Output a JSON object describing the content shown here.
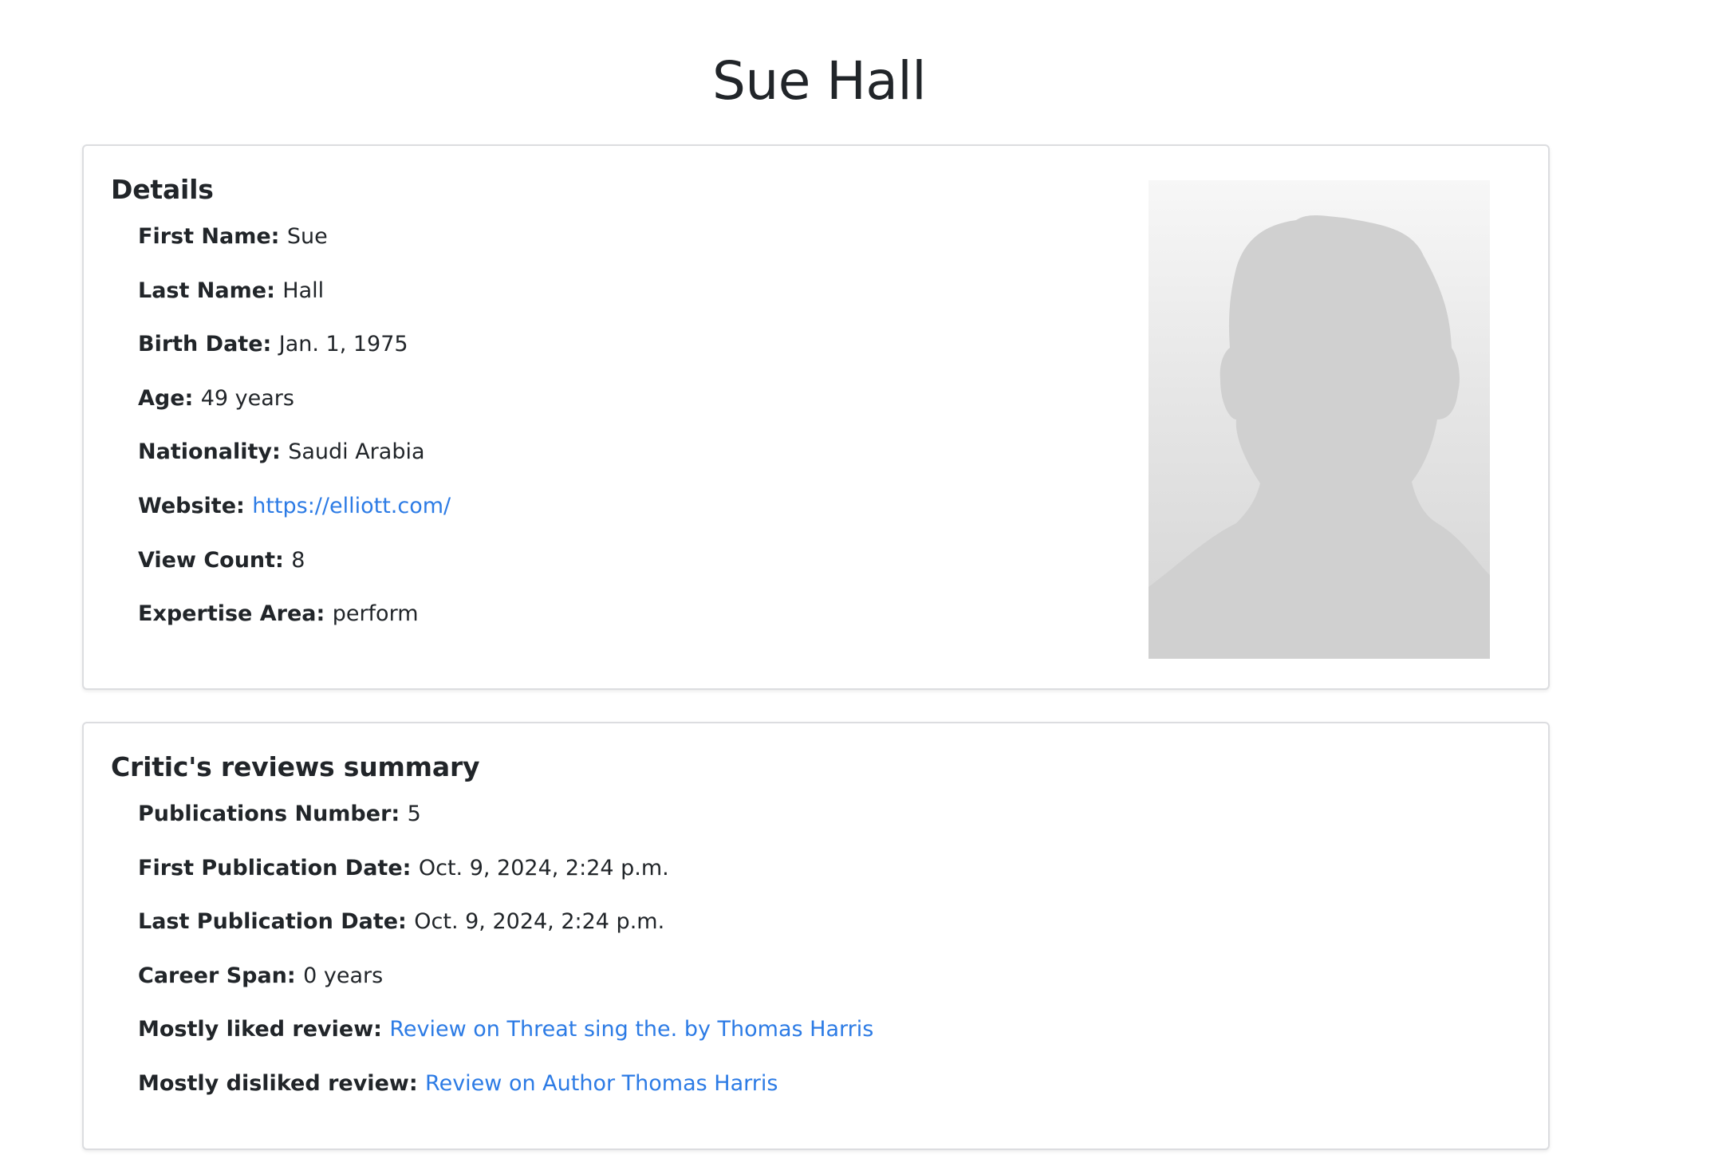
{
  "page": {
    "title": "Sue Hall"
  },
  "details": {
    "heading": "Details",
    "fields": [
      {
        "label": "First Name:",
        "value": "Sue"
      },
      {
        "label": "Last Name:",
        "value": "Hall"
      },
      {
        "label": "Birth Date:",
        "value": "Jan. 1, 1975"
      },
      {
        "label": "Age:",
        "value": "49 years"
      },
      {
        "label": "Nationality:",
        "value": "Saudi Arabia"
      },
      {
        "label": "Website:",
        "value": "https://elliott.com/"
      },
      {
        "label": "View Count:",
        "value": "8"
      },
      {
        "label": "Expertise Area:",
        "value": "perform"
      }
    ],
    "photo_icon": "person-silhouette-icon"
  },
  "reviews_summary": {
    "heading": "Critic's reviews summary",
    "fields": [
      {
        "label": "Publications Number:",
        "value": "5"
      },
      {
        "label": "First Publication Date:",
        "value": "Oct. 9, 2024, 2:24 p.m."
      },
      {
        "label": "Last Publication Date:",
        "value": "Oct. 9, 2024, 2:24 p.m."
      },
      {
        "label": "Career Span:",
        "value": "0 years"
      },
      {
        "label": "Mostly liked review:",
        "value": "Review on Threat sing the. by Thomas Harris"
      },
      {
        "label": "Mostly disliked review:",
        "value": "Review on Author Thomas Harris"
      }
    ]
  },
  "colors": {
    "text": "#212529",
    "link": "#2c7be5",
    "card_border": "#dcdde0",
    "silhouette": "#d0d0d0"
  }
}
